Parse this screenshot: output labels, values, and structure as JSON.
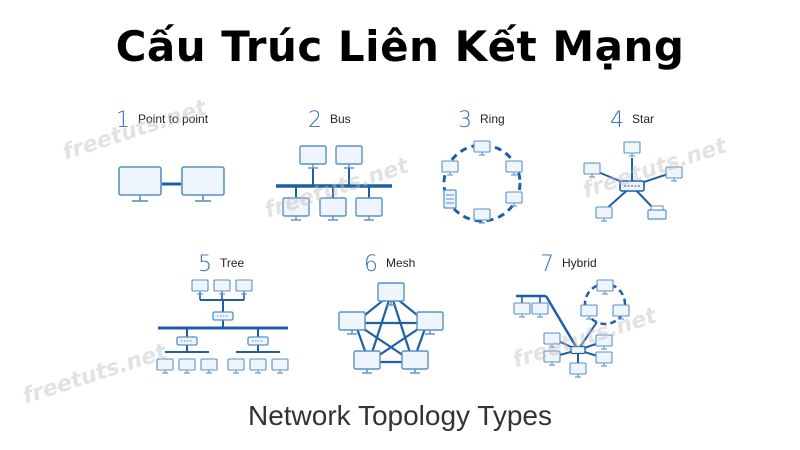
{
  "title": "Cấu Trúc Liên Kết Mạng",
  "caption": "Network Topology Types",
  "watermark": "freetuts.net",
  "accent_color": "#1f5fa8",
  "topologies": [
    {
      "num": "1",
      "label": "Point to point"
    },
    {
      "num": "2",
      "label": "Bus"
    },
    {
      "num": "3",
      "label": "Ring"
    },
    {
      "num": "4",
      "label": "Star"
    },
    {
      "num": "5",
      "label": "Tree"
    },
    {
      "num": "6",
      "label": "Mesh"
    },
    {
      "num": "7",
      "label": "Hybrid"
    }
  ]
}
